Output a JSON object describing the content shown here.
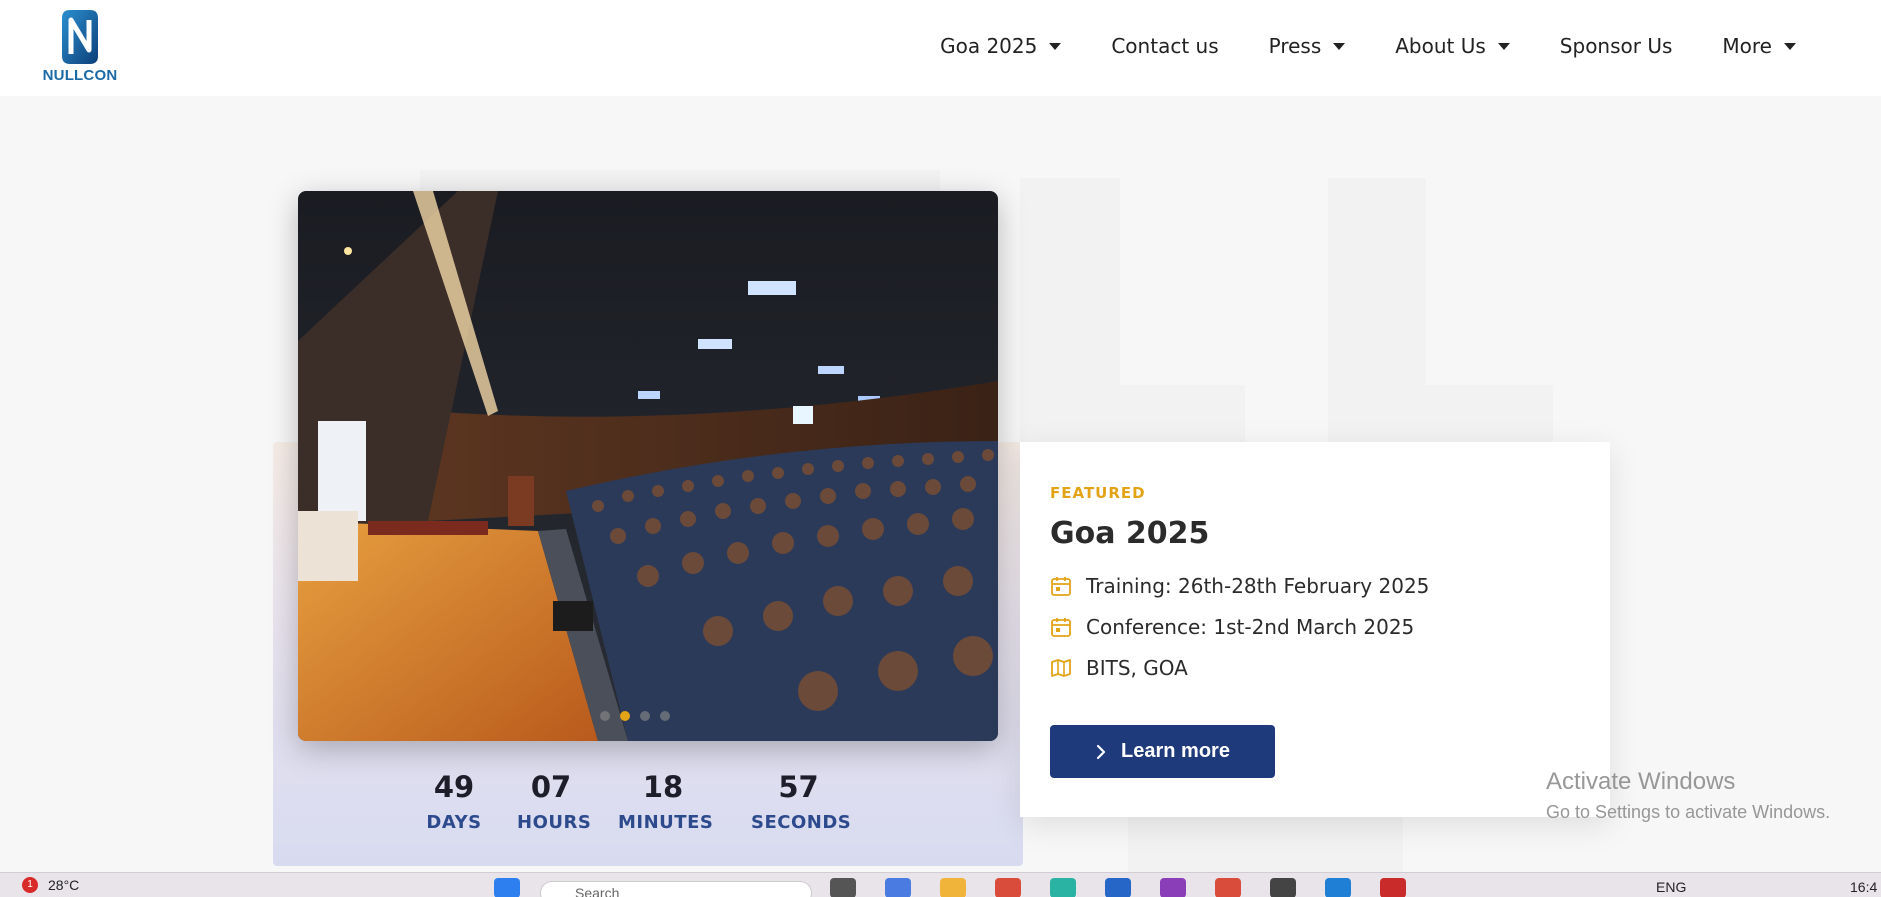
{
  "header": {
    "logo_text": "NULLCON",
    "nav": [
      {
        "label": "Goa 2025",
        "dropdown": true
      },
      {
        "label": "Contact us",
        "dropdown": false
      },
      {
        "label": "Press",
        "dropdown": true
      },
      {
        "label": "About Us",
        "dropdown": true
      },
      {
        "label": "Sponsor Us",
        "dropdown": false
      },
      {
        "label": "More",
        "dropdown": true
      }
    ]
  },
  "hero": {
    "image_icon": "conference-auditorium-photo",
    "carousel": {
      "total": 4,
      "active": 1
    },
    "countdown": [
      {
        "value": "49",
        "label": "DAYS"
      },
      {
        "value": "07",
        "label": "HOURS"
      },
      {
        "value": "18",
        "label": "MINUTES"
      },
      {
        "value": "57",
        "label": "SECONDS"
      }
    ]
  },
  "featured": {
    "eyebrow": "FEATURED",
    "title": "Goa 2025",
    "training": "Training: 26th-28th February 2025",
    "conference": "Conference: 1st-2nd March 2025",
    "venue": "BITS, GOA",
    "cta": "Learn more"
  },
  "watermark": {
    "title": "Activate Windows",
    "subtitle": "Go to Settings to activate Windows."
  },
  "taskbar": {
    "notification_count": "1",
    "temperature": "28°C",
    "search_placeholder": "Search",
    "language": "ENG",
    "time": "16:4"
  },
  "colors": {
    "brand_blue": "#1f3a7a",
    "accent_gold": "#e3a317",
    "countdown_label": "#2c4a8c"
  }
}
